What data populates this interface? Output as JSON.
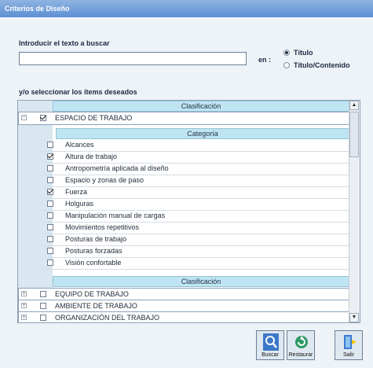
{
  "window": {
    "title": "Criterios de Diseño"
  },
  "search": {
    "label": "Introducir el texto a buscar",
    "value": "",
    "en_label": "en :",
    "options": [
      "Título",
      "Título/Contenido"
    ]
  },
  "select_label": "y/o seleccionar los ítems deseados",
  "tree": {
    "classification_header": "Clasificación",
    "category_header": "Categoría",
    "group1": {
      "label": "ESPACIO DE TRABAJO",
      "expander": "−",
      "checked": true
    },
    "items": [
      {
        "label": "Alcances",
        "checked": false
      },
      {
        "label": "Altura de trabajo",
        "checked": true
      },
      {
        "label": "Antropometría aplicada al diseño",
        "checked": false
      },
      {
        "label": "Espacio y zonas de paso",
        "checked": false
      },
      {
        "label": "Fuerza",
        "checked": true
      },
      {
        "label": "Holguras",
        "checked": false
      },
      {
        "label": "Manipulación manual de cargas",
        "checked": false
      },
      {
        "label": "Movimientos repetitivos",
        "checked": false
      },
      {
        "label": "Posturas de trabajo",
        "checked": false
      },
      {
        "label": "Posturas forzadas",
        "checked": false
      },
      {
        "label": "Visión confortable",
        "checked": false
      }
    ],
    "classification_header2": "Clasificación",
    "groups": [
      {
        "label": "EQUIPO DE TRABAJO",
        "expander": "+"
      },
      {
        "label": "AMBIENTE DE TRABAJO",
        "expander": "+"
      },
      {
        "label": "ORGANIZACIÓN DEL TRABAJO",
        "expander": "+"
      }
    ]
  },
  "buttons": {
    "buscar": "Buscar",
    "restaurar": "Restaurar",
    "salir": "Salir"
  },
  "colors": {
    "header_bg": "#bfe4f2",
    "title_bar": "#5c8fd3"
  }
}
